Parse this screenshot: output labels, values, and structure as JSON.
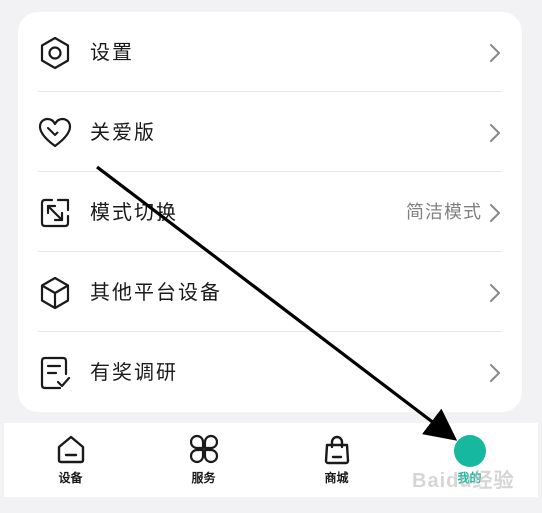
{
  "settings_list": [
    {
      "label": "设置",
      "icon": "hexagon-settings-icon",
      "value": ""
    },
    {
      "label": "关爱版",
      "icon": "heart-icon",
      "value": ""
    },
    {
      "label": "模式切换",
      "icon": "resize-arrows-icon",
      "value": "简洁模式"
    },
    {
      "label": "其他平台设备",
      "icon": "cube-icon",
      "value": ""
    },
    {
      "label": "有奖调研",
      "icon": "survey-checklist-icon",
      "value": ""
    }
  ],
  "tabbar": {
    "tabs": [
      {
        "label": "设备",
        "icon": "home-device-icon"
      },
      {
        "label": "服务",
        "icon": "four-petal-service-icon"
      },
      {
        "label": "商城",
        "icon": "shopping-bag-icon"
      },
      {
        "label": "我的",
        "icon": "profile-avatar-icon"
      }
    ],
    "active_index": 3,
    "active_color": "#16b9a0"
  },
  "watermark": {
    "text": "Baidu经验"
  },
  "colors": {
    "background": "#f2f2f4",
    "card": "#ffffff",
    "accent": "#16b9a0",
    "text": "#1a1a1a",
    "secondary_text": "#808080"
  }
}
